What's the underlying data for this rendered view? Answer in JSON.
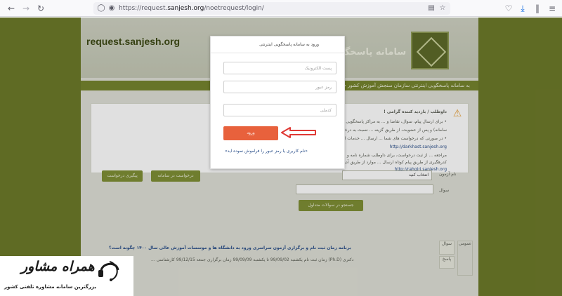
{
  "browser": {
    "url_prefix": "https://request.",
    "url_domain": "sanjesh.org",
    "url_path": "/noetrequest/login/",
    "icons": [
      "back-icon",
      "forward-icon",
      "reload-icon",
      "shield-icon",
      "lock-icon",
      "reader-icon",
      "bookmark-star-icon",
      "pocket-icon",
      "download-icon",
      "library-icon",
      "menu-icon"
    ]
  },
  "header": {
    "site_title": "request.sanjesh.org",
    "title_fa": "سامانه پاسخگ",
    "nav_text": "به سامانه پاسخگویی اینترنتی سازمان سنجش آموزش کشور خوش آمدید"
  },
  "notice": {
    "line1": "داوطلب / بازدید کننده گرامی !",
    "line2": "• برای ارسال پیام، سوال، تقاضا و ... به مراکز پاسخگویی اینترنتی request.sanjesh.org - فقط",
    "line3": "سامانه) و پس از عضویت، از طریق گزینه ... نسبت به درخواست خود اقدام و موفق وجود دارد.",
    "line4": "• در صورتی که درخواست های شما ... ارسال ... خدمات الکترونیکی به آدرس:",
    "link1": "http://darkhast.sanjesh.org",
    "line5": "مراجعه ... از ثبت درخواست، برای داوطلب شماره نامه و",
    "line6": "کدرهگیری از طریق پیام کوتاه ارسال ... موارد از طریق آدرس ... سامانه رهگیری مکاتبات به آدرس:",
    "link2": "http://rahgiri.sanjesh.org"
  },
  "form": {
    "subject_label": "نام آزمون",
    "subject_value": "انتخاب کنید",
    "question_label": "سوال",
    "search_button": "جستجو در سوالات متداول",
    "btn_new_request": "درخواست در سامانه",
    "btn_track": "پیگیری درخواست"
  },
  "news": {
    "tag_question": "سوال",
    "tag_answer": "پاسخ",
    "tag_category": "عمومی",
    "title": "برنامه زمان ثبت نام و برگزاری آزمون سراسری ورود به دانشگاه ها و موسسات آموزش عالی سال ۱۴۰۰ چگونه است؟",
    "meta": "دکتری (Ph.D) زمان ثبت نام یکشنبه 99/09/02 تا یکشنبه 99/09/09 زمان برگزاری جمعه 99/12/15 کارشناسی ..."
  },
  "modal": {
    "title": "ورود به سامانه پاسخگویی اینترنتی",
    "email_placeholder": "پست الکترونیک",
    "password_placeholder": "رمز عبور",
    "captcha_placeholder": "کدملی",
    "login_button": "ورود",
    "forgot_link": "«نام کاربری یا رمز عبور را فراموش نموده اید»"
  },
  "watermark": {
    "logo_text": "همراه مشاور",
    "subtitle": "بزرگترین سامانه مشاوره تلفنی کشور"
  },
  "colors": {
    "page_bg": "#6d7a2a",
    "login_button": "#e8613c",
    "arrow": "#e03a36",
    "link": "#2a4f8a"
  }
}
